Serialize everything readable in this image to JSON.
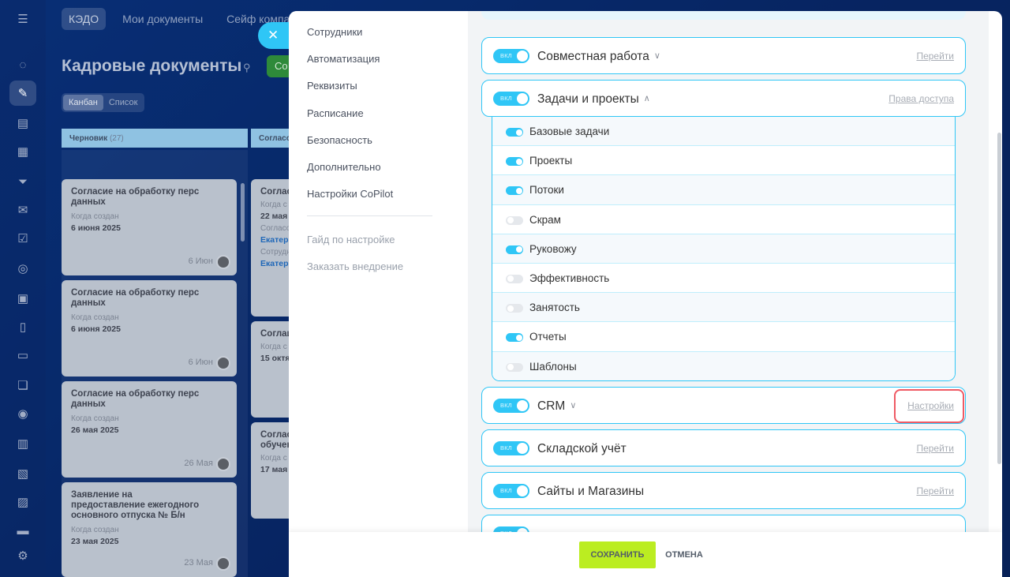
{
  "background": {
    "nav": {
      "kedo": "КЭДО",
      "my_docs": "Мои документы",
      "safe": "Сейф компании"
    },
    "page_title": "Кадровые документы",
    "create_button": "Со",
    "view_switch": {
      "kanban": "Канбан",
      "list": "Список"
    },
    "columns": [
      {
        "name": "Черновик",
        "count": "(27)"
      },
      {
        "name": "Согласо"
      }
    ],
    "cards": [
      {
        "title": "Согласие на обработку перс данных",
        "label": "Когда создан",
        "date": "6 июня 2025",
        "badge": "6 Июн"
      },
      {
        "title": "Согласие на обработку перс данных",
        "label": "Когда создан",
        "date": "6 июня 2025",
        "badge": "6 Июн"
      },
      {
        "title": "Согласие на обработку перс данных",
        "label": "Когда создан",
        "date": "26 мая 2025",
        "badge": "26 Мая"
      },
      {
        "title": "Заявление на предоставление ежегодного основного отпуска № Б/н",
        "label": "Когда создан",
        "date": "23 мая 2025",
        "badge": "23 Мая"
      }
    ],
    "cards_col2": [
      {
        "title": "Соглас",
        "label": "Когда с",
        "date": "22 мая",
        "label2": "Согласо",
        "name": "Екатер",
        "label3": "Сотрудн",
        "name2": "Екатер"
      },
      {
        "title": "Соглаш",
        "label": "Когда с",
        "date": "15 октя"
      },
      {
        "title": "Соглас",
        "title2": "обучен",
        "label": "Когда с",
        "date": "17 мая"
      }
    ]
  },
  "close_icon": "✕",
  "settings_nav": {
    "items": [
      "Сотрудники",
      "Автоматизация",
      "Реквизиты",
      "Расписание",
      "Безопасность",
      "Дополнительно",
      "Настройки CoPilot"
    ],
    "secondary": [
      "Гайд по настройке",
      "Заказать внедрение"
    ]
  },
  "modules": [
    {
      "name": "Совместная работа",
      "enabled": true,
      "expanded": false,
      "link": "Перейти"
    },
    {
      "name": "Задачи и проекты",
      "enabled": true,
      "expanded": true,
      "link": "Права доступа"
    },
    {
      "name": "CRM",
      "enabled": true,
      "expanded": false,
      "link": "Настройки"
    },
    {
      "name": "Складской учёт",
      "enabled": true,
      "link": "Перейти"
    },
    {
      "name": "Сайты и Магазины",
      "enabled": true,
      "link": "Перейти"
    }
  ],
  "task_submodules": [
    {
      "name": "Базовые задачи",
      "enabled": true
    },
    {
      "name": "Проекты",
      "enabled": true
    },
    {
      "name": "Потоки",
      "enabled": true
    },
    {
      "name": "Скрам",
      "enabled": false
    },
    {
      "name": "Руковожу",
      "enabled": true
    },
    {
      "name": "Эффективность",
      "enabled": false
    },
    {
      "name": "Занятость",
      "enabled": false
    },
    {
      "name": "Отчеты",
      "enabled": true
    },
    {
      "name": "Шаблоны",
      "enabled": false
    }
  ],
  "footer": {
    "save": "СОХРАНИТЬ",
    "cancel": "ОТМЕНА"
  },
  "colors": {
    "accent": "#2fc6f6",
    "save": "#bbed21",
    "highlight": "#ef5a64"
  }
}
